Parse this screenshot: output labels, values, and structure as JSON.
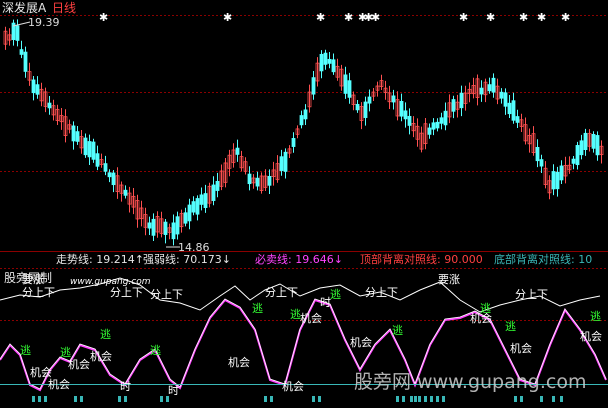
{
  "header": {
    "stock_name": "深发展A",
    "period": "日线"
  },
  "upper_panel": {
    "high_price": "19.39",
    "low_price": "14.86"
  },
  "indicator_panel": {
    "title": "股旁网制",
    "watermark_text": "www.gupang.com",
    "values": [
      {
        "label": "走势线:",
        "value": "19.214",
        "arrow": "↑",
        "color": "#e6e6e6"
      },
      {
        "label": "强弱线:",
        "value": "70.173",
        "arrow": "↓",
        "color": "#e6e6e6"
      },
      {
        "label": "必卖线:",
        "value": "19.646",
        "arrow": "↓",
        "color": "#ff44ff"
      },
      {
        "label": "顶部背离对照线:",
        "value": "90.000",
        "arrow": "",
        "color": "#ff4040"
      },
      {
        "label": "底部背离对照线:",
        "value": "10",
        "arrow": "",
        "color": "#39b7b7"
      }
    ],
    "annotations": [
      {
        "text": "分上下",
        "kind": "white"
      },
      {
        "text": "分上下",
        "kind": "white"
      },
      {
        "text": "分上下",
        "kind": "white"
      },
      {
        "text": "分上下",
        "kind": "white"
      },
      {
        "text": "分上下",
        "kind": "white"
      },
      {
        "text": "分上下",
        "kind": "white"
      },
      {
        "text": "要涨",
        "kind": "white"
      },
      {
        "text": "要涨",
        "kind": "white"
      },
      {
        "text": "机会",
        "kind": "white"
      },
      {
        "text": "机会",
        "kind": "white"
      },
      {
        "text": "机会",
        "kind": "white"
      },
      {
        "text": "机会",
        "kind": "white"
      },
      {
        "text": "机会",
        "kind": "white"
      },
      {
        "text": "机会",
        "kind": "white"
      },
      {
        "text": "机会",
        "kind": "white"
      },
      {
        "text": "机会",
        "kind": "white"
      },
      {
        "text": "机会",
        "kind": "white"
      },
      {
        "text": "机会",
        "kind": "white"
      },
      {
        "text": "机会",
        "kind": "white"
      },
      {
        "text": "时",
        "kind": "white"
      },
      {
        "text": "时",
        "kind": "white"
      },
      {
        "text": "时",
        "kind": "white"
      },
      {
        "text": "逃",
        "kind": "green"
      },
      {
        "text": "逃",
        "kind": "green"
      },
      {
        "text": "逃",
        "kind": "green"
      },
      {
        "text": "逃",
        "kind": "green"
      },
      {
        "text": "逃",
        "kind": "green"
      },
      {
        "text": "逃",
        "kind": "green"
      },
      {
        "text": "逃",
        "kind": "green"
      },
      {
        "text": "逃",
        "kind": "green"
      },
      {
        "text": "逃",
        "kind": "green"
      },
      {
        "text": "逃",
        "kind": "green"
      },
      {
        "text": "逃",
        "kind": "green"
      }
    ]
  },
  "watermark": "股旁网 www.gupang.com",
  "colors": {
    "background": "#000000",
    "up_candle": "#ff5050",
    "down_candle": "#54ffff",
    "grid": "#8b0000",
    "bottom_line": "#39b7b7",
    "pink_line": "#ff44ff"
  }
}
